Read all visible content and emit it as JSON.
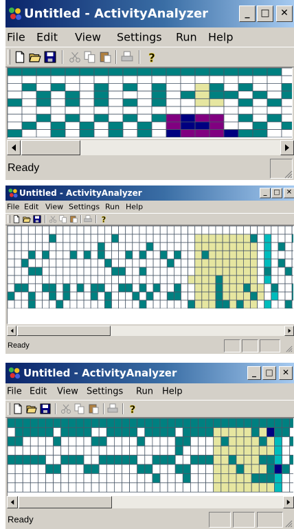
{
  "windows": [
    {
      "title": "Untitled - ActivityAnalyzer",
      "menu": [
        "File",
        "Edit",
        "View",
        "Settings",
        "Run",
        "Help"
      ],
      "status": "Ready",
      "grid": {
        "rows": [
          "ttttttttttttttttttt.",
          "....................",
          ".t.t..t.t.t..yt.t..t",
          "..t.t.t...t.tytt.t.t",
          "t.t.t.t.t.t..yy.t.t.",
          "....................",
          "..t.t.t.t.tpnpp.t.t.",
          ".t.t.t.t.t.pnnp..t.t",
          "t..t.t.t.t.npppntt.."
        ]
      }
    },
    {
      "title": "Untitled - ActivityAnalyzer",
      "menu": [
        "File",
        "Edit",
        "View",
        "Settings",
        "Run",
        "Help"
      ],
      "status": "Ready",
      "grid": {
        "rows": [
          "................................................",
          "......t........t...........yyyyyyyyt.c...t.t..t.",
          ".............t......t......yyyyyyyyy.c.t....t...",
          "...t.t...t.t.t...t.t..t.t..ytyyyyyyy.c.......t..",
          "..t...........t........t...yyyyyyyyy.c.t.....t..",
          "...tt..........tt..t.......yyyyyyyyy.t..t.......",
          "..........................yyyytyyyyy.c..........",
          ".tt..tt.t.t.tt..tt.t.t..t..yyytyyytyy.t..tt..t..",
          "t..t..t.t...t.t...t.t..tt..yyytyyyyty.c..t.t..t.",
          "...t...t......t....t......tyyyttytyy.c..t.t....t"
        ]
      }
    },
    {
      "title": "Untitled - ActivityAnalyzer",
      "menu": [
        "File",
        "Edit",
        "View",
        "Settings",
        "Run",
        "Help"
      ],
      "status": "Ready",
      "grid": {
        "rows": [
          "ttttttttttttttttttttttttttttttttttttttttttt.",
          ".ttttt.tttt..tttt.tttt.ttttyyyyytyntt..ttt..",
          "tt....t....tt....t....tt...ytyyyytyc.tt...tt",
          "......................t....yyyyyyyyc........",
          "ttttt..ttt..ttttt..ttt..tttyytyyyttc.tttt.t.",
          ".....tt...tt.....tt...tt...yyytyyytnt....t.t",
          "...................t...t...yyyyytttc........",
          "...........................yyyyyyyyc........"
        ]
      }
    }
  ],
  "colors": {
    "teal": "#008080",
    "yellow": "#e6e6a0",
    "purple": "#800080",
    "navy": "#000080",
    "cyan": "#00bcbc",
    "dark": "#053040",
    "grid_line": "#4a5868"
  },
  "toolbar_icons": [
    "new-document-icon",
    "open-folder-icon",
    "save-disk-icon",
    "cut-scissors-icon",
    "copy-icon",
    "paste-icon",
    "print-icon",
    "help-question-icon"
  ],
  "window_buttons": [
    "minimize",
    "maximize",
    "close"
  ]
}
